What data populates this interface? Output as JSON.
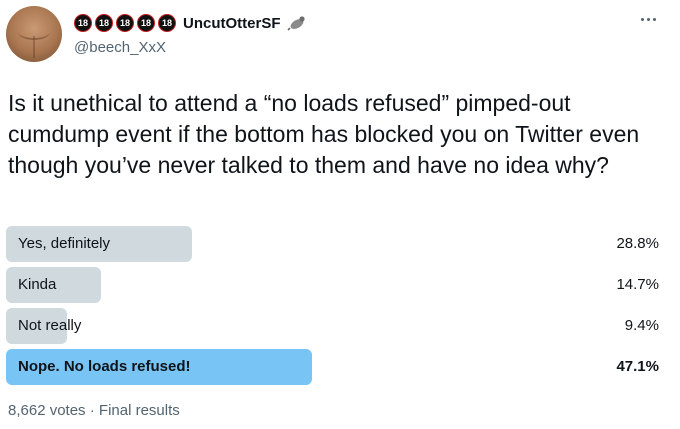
{
  "header": {
    "badges": [
      "18",
      "18",
      "18",
      "18",
      "18"
    ],
    "display_name": "UncutOtterSF",
    "handle": "@beech_XxX"
  },
  "tweet": {
    "text": "Is it unethical to attend a “no loads refused” pimped-out cumdump event if the bottom has blocked you on Twitter even though you’ve never talked to them and have no idea why?"
  },
  "poll": {
    "options": [
      {
        "label": "Yes, definitely",
        "percent": "28.8%",
        "value": 28.8
      },
      {
        "label": "Kinda",
        "percent": "14.7%",
        "value": 14.7
      },
      {
        "label": "Not really",
        "percent": "9.4%",
        "value": 9.4
      },
      {
        "label": "Nope. No loads refused!",
        "percent": "47.1%",
        "value": 47.1,
        "winner": true
      }
    ],
    "votes": "8,662 votes",
    "separator": "·",
    "status": "Final results"
  },
  "colors": {
    "bar": "#cfd9de",
    "winner_bar": "#78c5f5",
    "secondary_text": "#536471"
  }
}
